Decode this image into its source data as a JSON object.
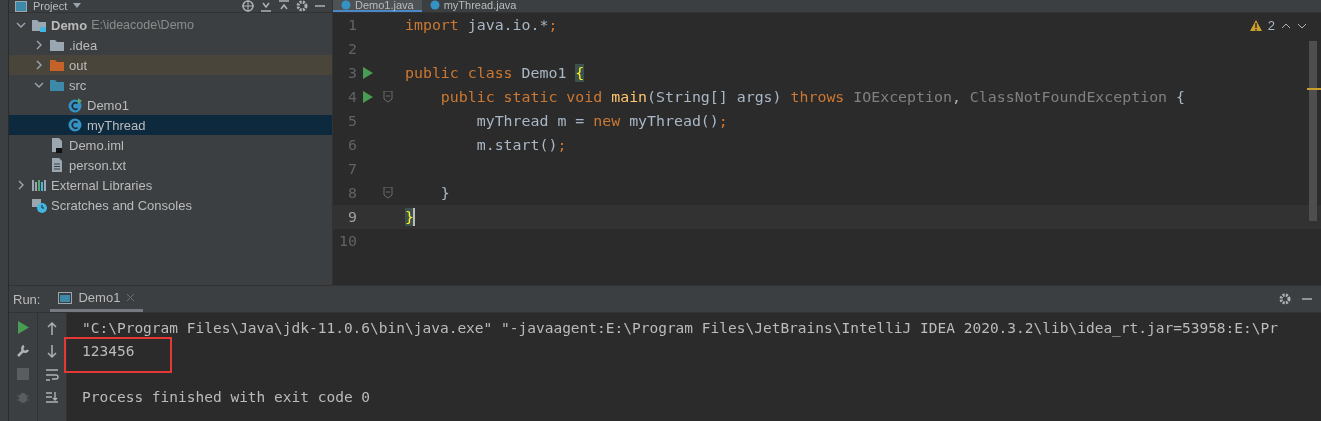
{
  "project_panel": {
    "title": "Project",
    "tree": [
      {
        "label": "Demo",
        "path": "E:\\ideacode\\Demo",
        "kind": "module",
        "expanded": true,
        "selected": false,
        "children": [
          {
            "label": ".idea",
            "kind": "folder",
            "expanded": false,
            "selected": false
          },
          {
            "label": "out",
            "kind": "excluded-folder",
            "expanded": false,
            "selected": false
          },
          {
            "label": "src",
            "kind": "source-folder",
            "expanded": true,
            "selected": false,
            "children": [
              {
                "label": "Demo1",
                "kind": "runnable-class",
                "selected": false
              },
              {
                "label": "myThread",
                "kind": "class",
                "selected": true
              }
            ]
          },
          {
            "label": "Demo.iml",
            "kind": "iml-file",
            "selected": false
          },
          {
            "label": "person.txt",
            "kind": "text-file",
            "selected": false
          }
        ]
      },
      {
        "label": "External Libraries",
        "kind": "libraries",
        "expanded": false,
        "selected": false
      },
      {
        "label": "Scratches and Consoles",
        "kind": "scratches",
        "selected": false
      }
    ]
  },
  "editor": {
    "tabs": [
      {
        "label": "Demo1.java",
        "selected": true
      },
      {
        "label": "myThread.java",
        "selected": false
      }
    ],
    "warning_count": "2",
    "lines": [
      {
        "number": "1",
        "tokens": [
          {
            "kind": "keyword",
            "text": "import"
          },
          {
            "kind": "plain",
            "text": " java.io.*"
          },
          {
            "kind": "keyword",
            "text": ";"
          }
        ]
      },
      {
        "number": "2"
      },
      {
        "number": "3",
        "run": true,
        "tokens": [
          {
            "kind": "keyword",
            "text": "public class"
          },
          {
            "kind": "plain",
            "text": " Demo1 "
          },
          {
            "kind": "brace-match",
            "text": "{"
          }
        ]
      },
      {
        "number": "4",
        "run": true,
        "fold": true,
        "tokens": [
          {
            "kind": "keyword",
            "text": "    public static void "
          },
          {
            "kind": "method",
            "text": "main"
          },
          {
            "kind": "plain",
            "text": "(String[] args) "
          },
          {
            "kind": "keyword",
            "text": "throws "
          },
          {
            "kind": "unused",
            "text": "IOException"
          },
          {
            "kind": "plain",
            "text": ", "
          },
          {
            "kind": "unused",
            "text": "ClassNotFoundException"
          },
          {
            "kind": "plain",
            "text": " {"
          }
        ]
      },
      {
        "number": "5",
        "tokens": [
          {
            "kind": "plain",
            "text": "        myThread m = "
          },
          {
            "kind": "keyword",
            "text": "new"
          },
          {
            "kind": "plain",
            "text": " myThread()"
          },
          {
            "kind": "keyword",
            "text": ";"
          }
        ]
      },
      {
        "number": "6",
        "tokens": [
          {
            "kind": "plain",
            "text": "        m.start()"
          },
          {
            "kind": "keyword",
            "text": ";"
          }
        ]
      },
      {
        "number": "7"
      },
      {
        "number": "8",
        "fold": true,
        "tokens": [
          {
            "kind": "plain",
            "text": "    }"
          }
        ]
      },
      {
        "number": "9",
        "current": true,
        "tokens": [
          {
            "kind": "brace-match",
            "text": "}"
          }
        ]
      },
      {
        "number": "10"
      }
    ]
  },
  "run_panel": {
    "label": "Run:",
    "tabs": [
      {
        "label": "Demo1",
        "selected": true
      }
    ],
    "console": [
      {
        "kind": "command",
        "text": "\"C:\\Program Files\\Java\\jdk-11.0.6\\bin\\java.exe\" \"-javaagent:E:\\Program Files\\JetBrains\\IntelliJ IDEA 2020.3.2\\lib\\idea_rt.jar=53958:E:\\Pr",
        "highlighted": false
      },
      {
        "kind": "output",
        "text": "123456",
        "highlighted": true
      },
      {
        "kind": "status",
        "text": "Process finished with exit code 0",
        "highlighted": false
      }
    ]
  }
}
